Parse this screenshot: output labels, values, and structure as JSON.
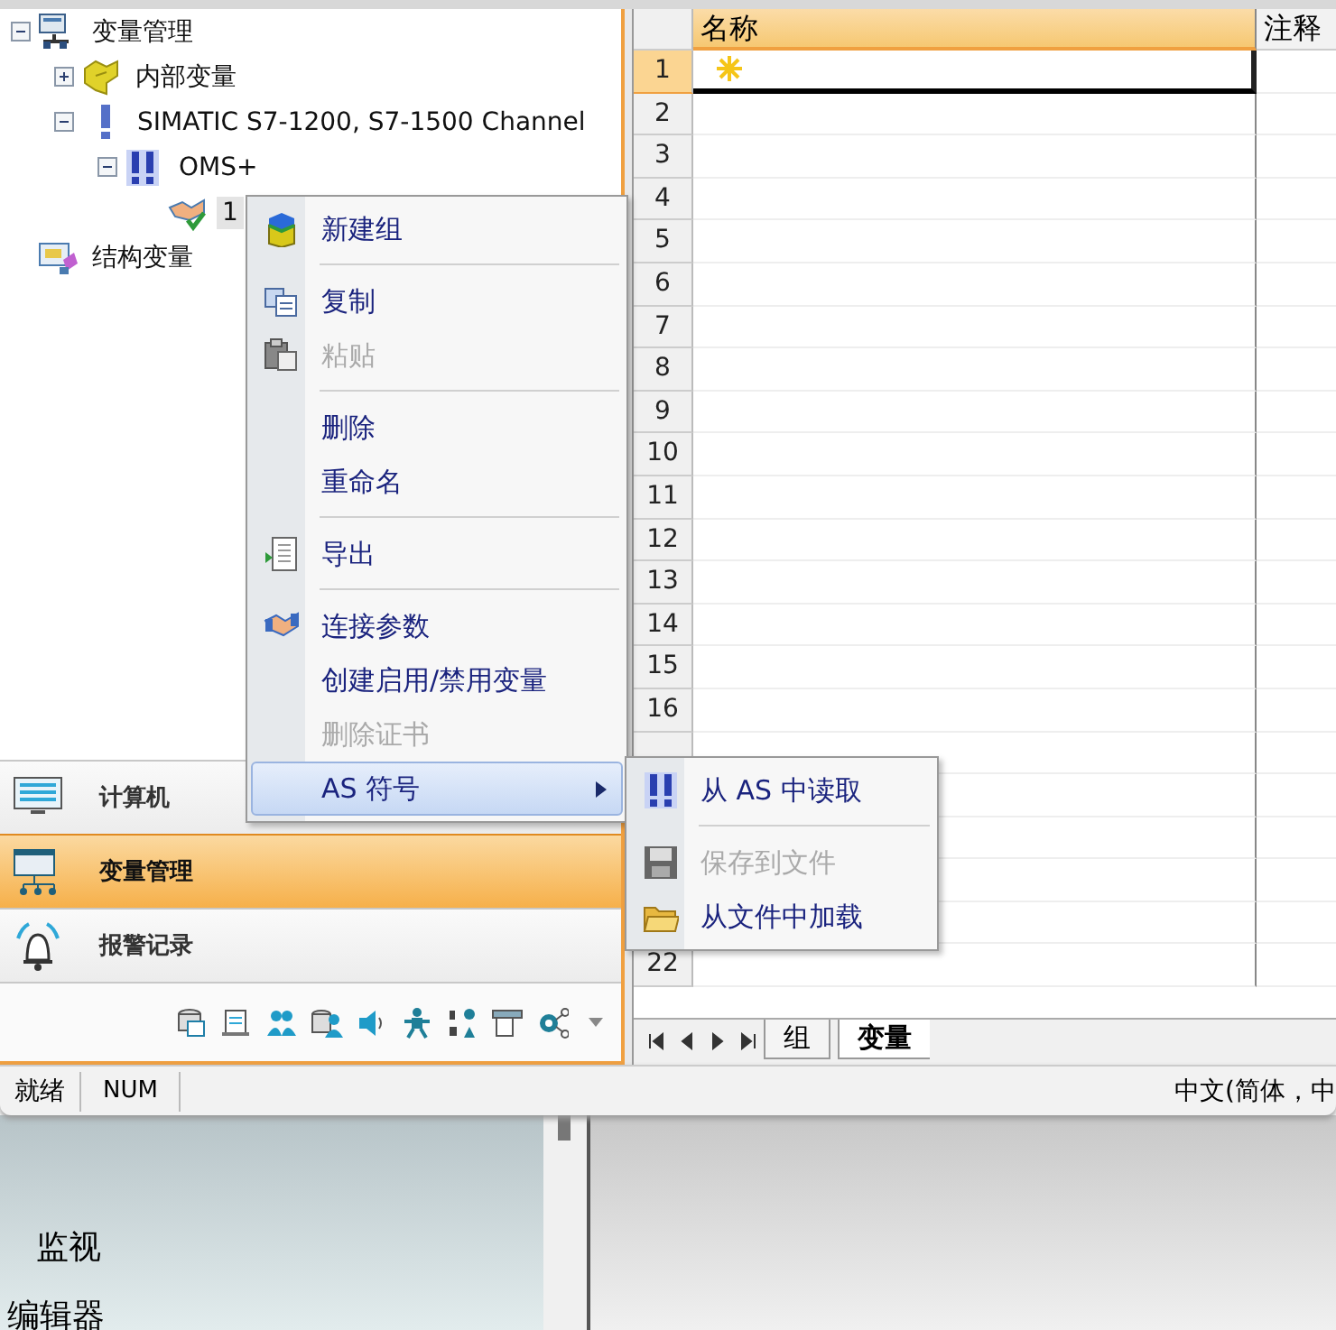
{
  "tree": [
    {
      "label": "变量管理",
      "expanded": true,
      "selected": false,
      "children": [
        {
          "label": "内部变量",
          "expanded": false,
          "selected": false
        },
        {
          "label": "SIMATIC S7-1200, S7-1500 Channel",
          "expanded": true,
          "selected": false,
          "children": [
            {
              "label": "OMS+",
              "expanded": true,
              "selected": false,
              "children": [
                {
                  "label": "1",
                  "selected": true
                }
              ]
            }
          ]
        }
      ]
    },
    {
      "label": "结构变量",
      "selected": false
    }
  ],
  "nav_buttons": [
    {
      "label": "计算机",
      "selected": false
    },
    {
      "label": "变量管理",
      "selected": true
    },
    {
      "label": "报警记录",
      "selected": false
    }
  ],
  "context_menu": [
    {
      "kind": "item",
      "label": "新建组",
      "disabled": false,
      "selected": false,
      "submenu": false
    },
    {
      "kind": "separator"
    },
    {
      "kind": "item",
      "label": "复制",
      "disabled": false,
      "selected": false,
      "submenu": false
    },
    {
      "kind": "item",
      "label": "粘贴",
      "disabled": true,
      "selected": false,
      "submenu": false
    },
    {
      "kind": "separator"
    },
    {
      "kind": "item",
      "label": "删除",
      "disabled": false,
      "selected": false,
      "submenu": false
    },
    {
      "kind": "item",
      "label": "重命名",
      "disabled": false,
      "selected": false,
      "submenu": false
    },
    {
      "kind": "separator"
    },
    {
      "kind": "item",
      "label": "导出",
      "disabled": false,
      "selected": false,
      "submenu": false
    },
    {
      "kind": "separator"
    },
    {
      "kind": "item",
      "label": "连接参数",
      "disabled": false,
      "selected": false,
      "submenu": false
    },
    {
      "kind": "item",
      "label": "创建启用/禁用变量",
      "disabled": false,
      "selected": false,
      "submenu": false
    },
    {
      "kind": "item",
      "label": "删除证书",
      "disabled": true,
      "selected": false,
      "submenu": false
    },
    {
      "kind": "item",
      "label": "AS 符号",
      "disabled": false,
      "selected": true,
      "submenu": true
    }
  ],
  "submenu": [
    {
      "kind": "item",
      "label": "从 AS 中读取",
      "disabled": false,
      "selected": false,
      "submenu": false
    },
    {
      "kind": "separator"
    },
    {
      "kind": "item",
      "label": "保存到文件",
      "disabled": true,
      "selected": false,
      "submenu": false
    },
    {
      "kind": "item",
      "label": "从文件中加载",
      "disabled": false,
      "selected": false,
      "submenu": false
    }
  ],
  "table": {
    "columns": [
      "名称",
      "注释"
    ],
    "rows": [
      {
        "number": "1",
        "selected": true
      },
      {
        "number": "2",
        "selected": false
      },
      {
        "number": "3",
        "selected": false
      },
      {
        "number": "4",
        "selected": false
      },
      {
        "number": "5",
        "selected": false
      },
      {
        "number": "6",
        "selected": false
      },
      {
        "number": "7",
        "selected": false
      },
      {
        "number": "8",
        "selected": false
      },
      {
        "number": "9",
        "selected": false
      },
      {
        "number": "10",
        "selected": false
      },
      {
        "number": "11",
        "selected": false
      },
      {
        "number": "12",
        "selected": false
      },
      {
        "number": "13",
        "selected": false
      },
      {
        "number": "14",
        "selected": false
      },
      {
        "number": "15",
        "selected": false
      },
      {
        "number": "16",
        "selected": false
      },
      {},
      {},
      {},
      {},
      {},
      {
        "number": "22",
        "selected": false
      }
    ]
  },
  "sheet_tabs": [
    {
      "label": "组",
      "selected": false
    },
    {
      "label": "变量",
      "selected": true
    }
  ],
  "status_bar": [
    "就绪",
    "NUM",
    "中文(简体，中"
  ],
  "background_window": {
    "items": [
      "监视",
      "编辑器"
    ]
  }
}
